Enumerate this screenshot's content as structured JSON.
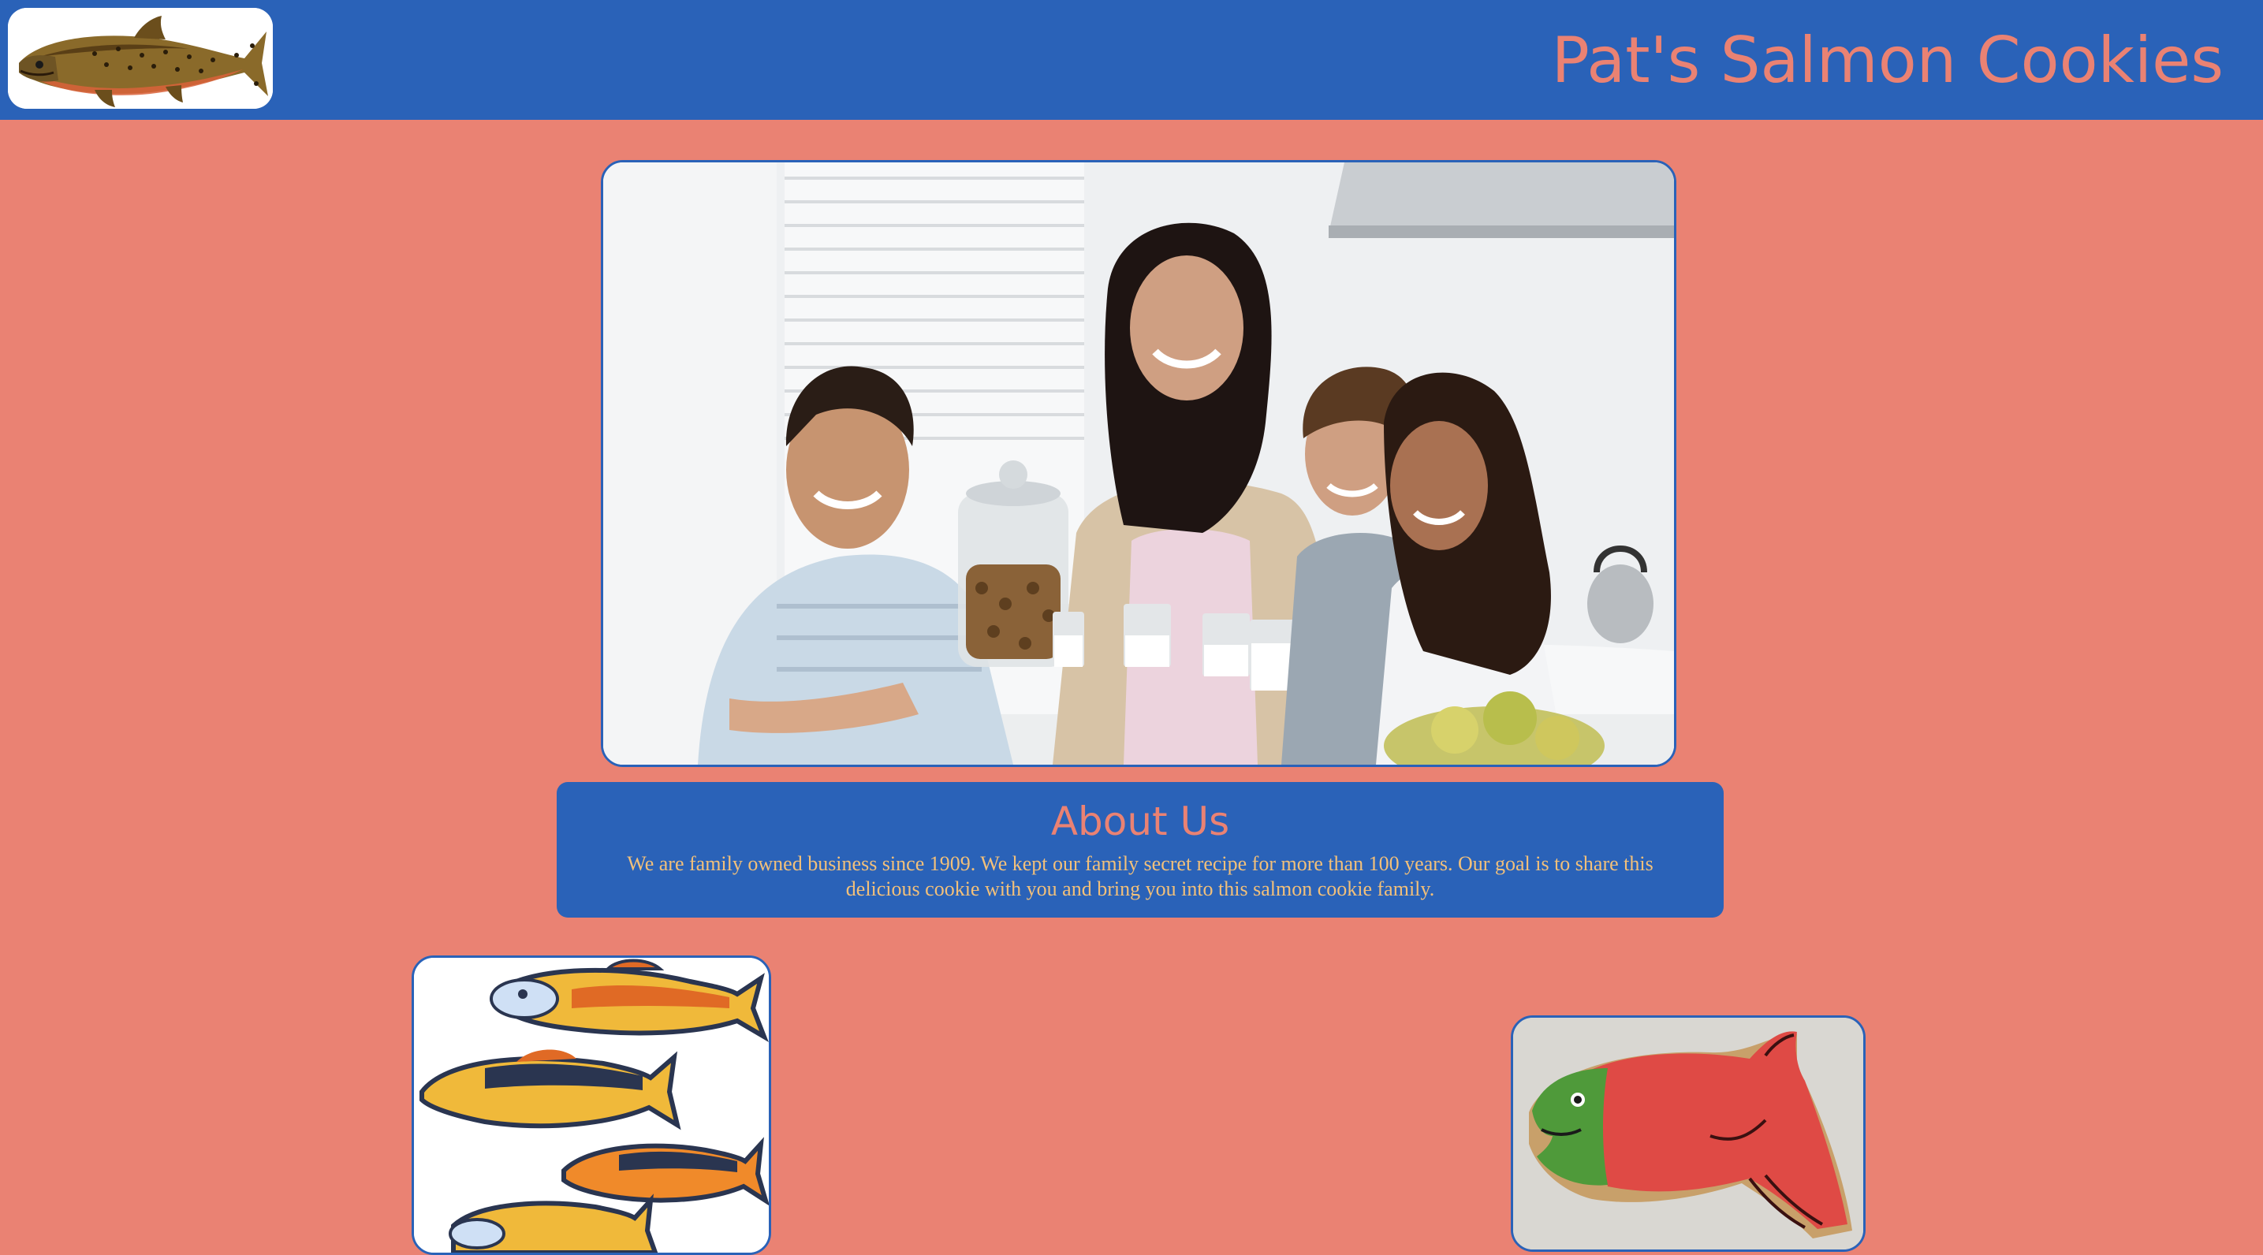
{
  "header": {
    "title": "Pat's Salmon Cookies",
    "logo_icon": "salmon-logo-icon",
    "background": "#2a62b8",
    "title_color": "#ea8273"
  },
  "hero": {
    "image": "family-kitchen-photo"
  },
  "about": {
    "title": "About Us",
    "text": "We are family owned business since 1909. We kept our family secret recipe for more than 100 years. Our goal is to share this delicious cookie with you and bring you into this salmon cookie family."
  },
  "gallery": {
    "left_image": "decorated-salmon-cookies-photo",
    "right_image": "red-green-salmon-cookie-photo"
  },
  "colors": {
    "page_background": "#ea8273",
    "accent_blue": "#2a62b8",
    "about_text": "#f2c07a"
  }
}
